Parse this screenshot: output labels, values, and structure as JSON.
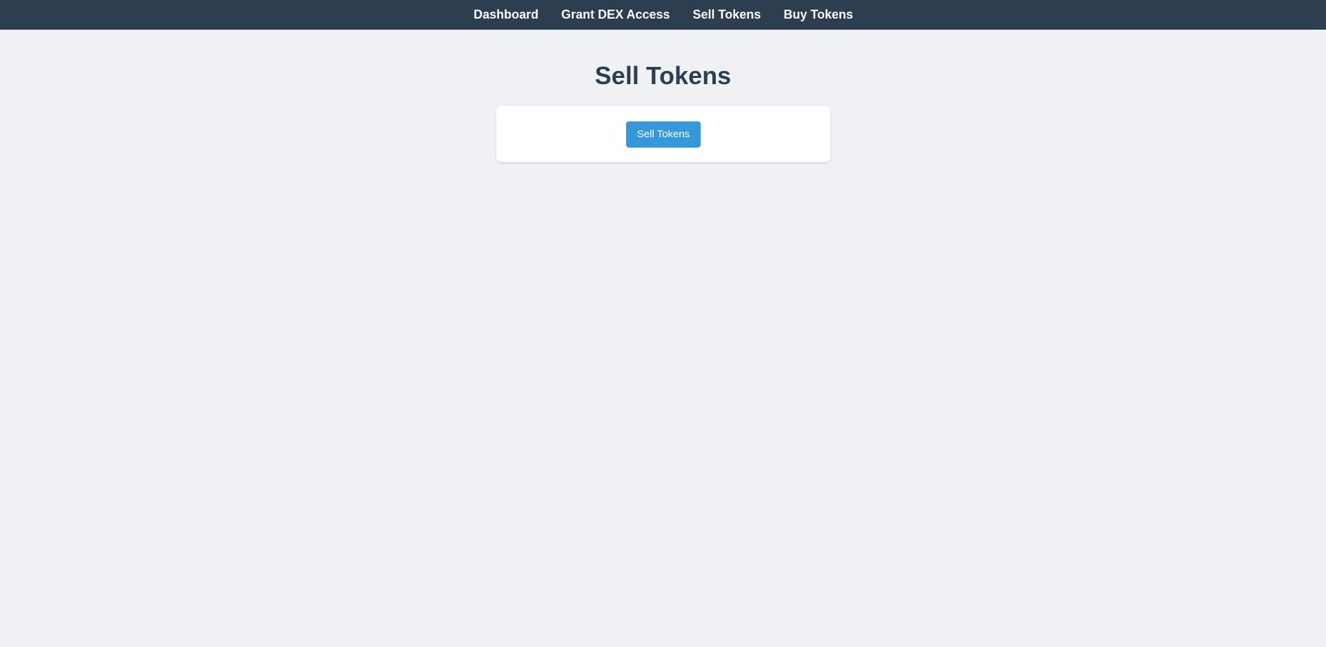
{
  "nav": {
    "items": [
      {
        "label": "Dashboard"
      },
      {
        "label": "Grant DEX Access"
      },
      {
        "label": "Sell Tokens"
      },
      {
        "label": "Buy Tokens"
      }
    ]
  },
  "main": {
    "title": "Sell Tokens",
    "sell_button_label": "Sell Tokens"
  },
  "colors": {
    "navbar_bg": "#2d3e50",
    "page_bg": "#eff1f5",
    "title_text": "#2c3e50",
    "button_bg": "#3498db"
  }
}
